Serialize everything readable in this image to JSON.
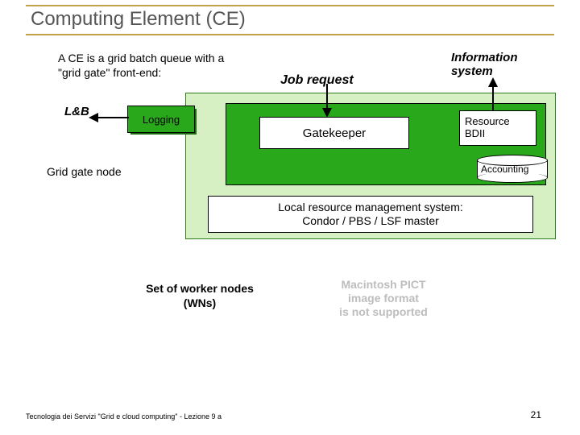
{
  "title": "Computing Element (CE)",
  "intro": "A CE is a grid batch queue with a \"grid gate\" front-end:",
  "labels": {
    "job_request": "Job request",
    "info_system": "Information\nsystem",
    "lnb": "L&B",
    "logging": "Logging",
    "gatekeeper": "Gatekeeper",
    "resource_bdii": "Resource\nBDII",
    "accounting": "Accounting",
    "grid_gate_node": "Grid gate node",
    "lrms_1": "Local resource management system:",
    "lrms_2": "Condor / PBS / LSF master",
    "wns": "Set of worker nodes\n(WNs)",
    "pict": "Macintosh PICT\nimage format\nis not supported"
  },
  "footer": {
    "left": "Tecnologia dei Servizi \"Grid e cloud computing\" - Lezione 9 a",
    "right": "21"
  },
  "colors": {
    "accent": "#bfa24a",
    "box_fill": "#d6f0c4",
    "box_border": "#2e7d1e",
    "inner_green": "#2aa81c"
  }
}
